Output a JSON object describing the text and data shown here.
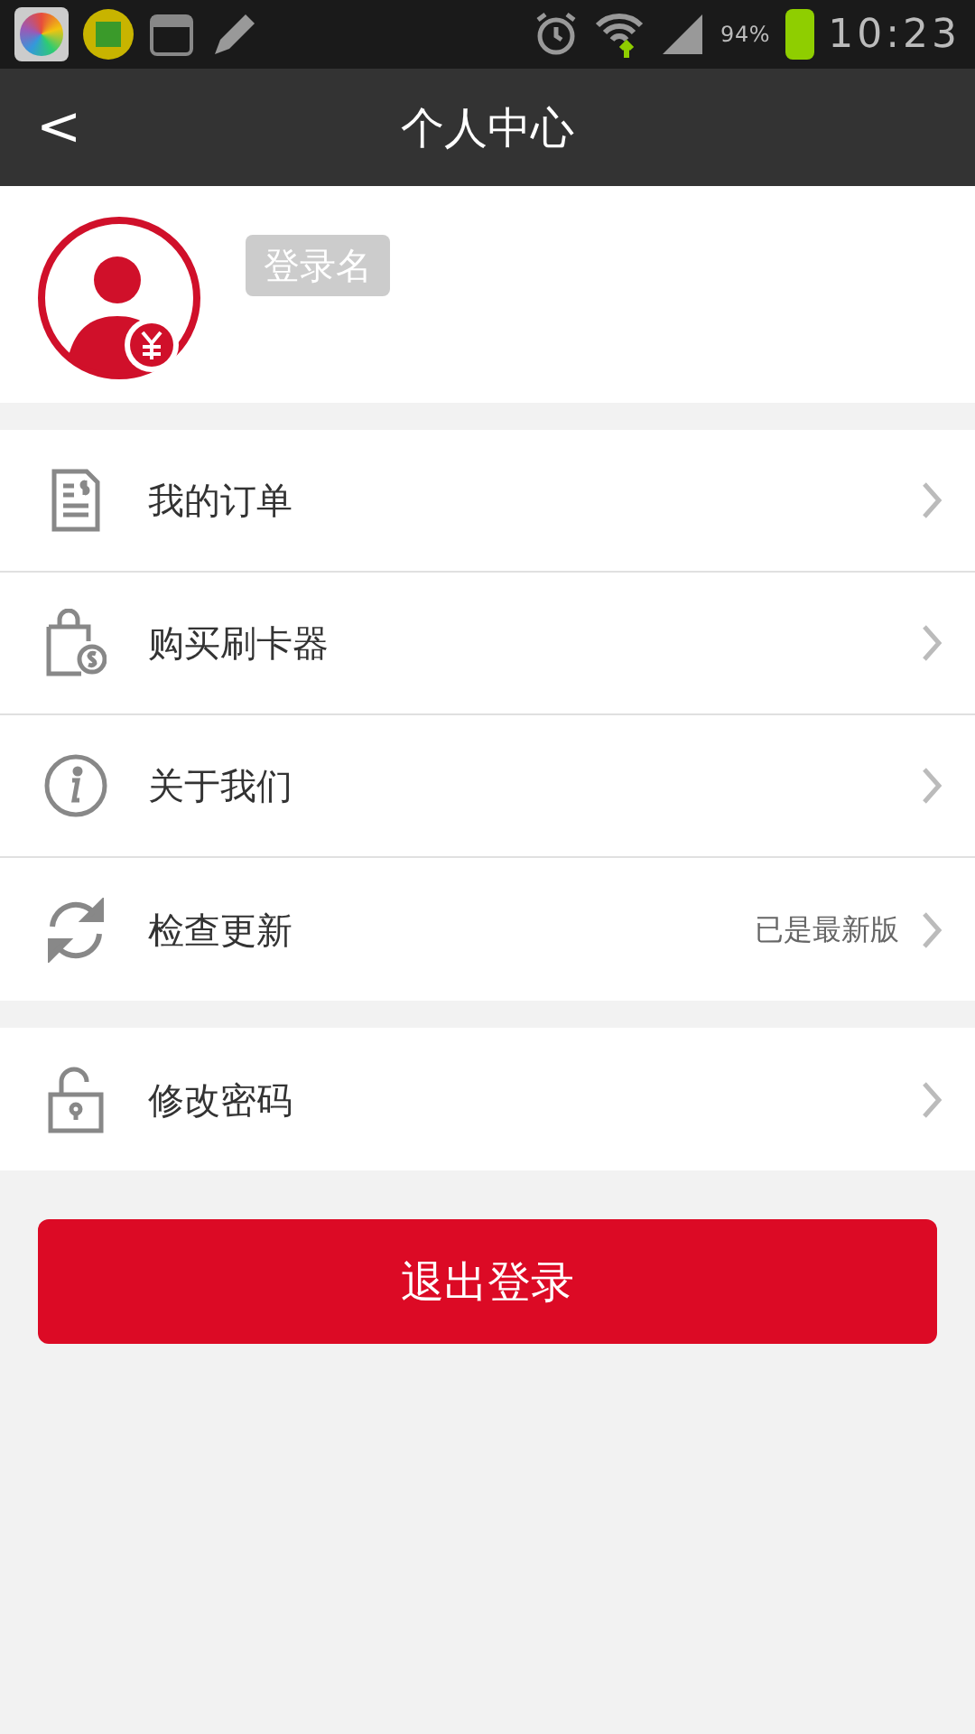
{
  "status_bar": {
    "battery": "94%",
    "time": "10:23"
  },
  "header": {
    "back": "<",
    "title": "个人中心"
  },
  "profile": {
    "login_name": "登录名"
  },
  "menu_groups": [
    {
      "items": [
        {
          "kind": "orders",
          "label": "我的订单"
        },
        {
          "kind": "shop",
          "label": "购买刷卡器"
        },
        {
          "kind": "info",
          "label": "关于我们"
        },
        {
          "kind": "refresh",
          "label": "检查更新",
          "value": "已是最新版"
        }
      ]
    },
    {
      "items": [
        {
          "kind": "lock",
          "label": "修改密码"
        }
      ]
    }
  ],
  "logout_button": "退出登录"
}
